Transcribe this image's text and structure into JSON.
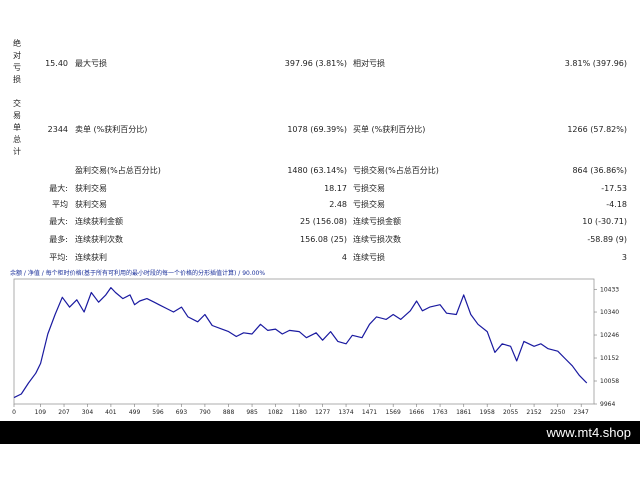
{
  "report": {
    "section1_label": "绝对亏损",
    "section2_label": "交易单总计",
    "rows": [
      {
        "c1": "15.40",
        "c2": "最大亏损",
        "c3": "397.96 (3.81%)",
        "c4": "相对亏损",
        "c5": "3.81% (397.96)"
      },
      {
        "c1": "2344",
        "c2": "卖单 (%获利百分比)",
        "c3": "1078 (69.39%)",
        "c4": "买单 (%获利百分比)",
        "c5": "1266 (57.82%)"
      },
      {
        "c1": "",
        "c2": "盈利交易(%占总百分比)",
        "c3": "1480 (63.14%)",
        "c4": "亏损交易(%占总百分比)",
        "c5": "864 (36.86%)"
      },
      {
        "c1": "最大:",
        "c2": "获利交易",
        "c3": "18.17",
        "c4": "亏损交易",
        "c5": "-17.53"
      },
      {
        "c1": "平均",
        "c2": "获利交易",
        "c3": "2.48",
        "c4": "亏损交易",
        "c5": "-4.18"
      },
      {
        "c1": "最大:",
        "c2": "连续获利金额",
        "c3": "25 (156.08)",
        "c4": "连续亏损金额",
        "c5": "10 (-30.71)"
      },
      {
        "c1": "最多:",
        "c2": "连续获利次数",
        "c3": "156.08 (25)",
        "c4": "连续亏损次数",
        "c5": "-58.89 (9)"
      },
      {
        "c1": "平均:",
        "c2": "连续获利",
        "c3": "4",
        "c4": "连续亏损",
        "c5": "3"
      }
    ]
  },
  "chart_data": {
    "type": "line",
    "title": "余额 / 净值 / 每个柜时价格(基于所有可利用的最小时段的每一个价格的分形插值计算) / 90.00%",
    "x_ticks": [
      "0",
      "109",
      "207",
      "304",
      "401",
      "499",
      "596",
      "693",
      "790",
      "888",
      "985",
      "1082",
      "1180",
      "1277",
      "1374",
      "1471",
      "1569",
      "1666",
      "1763",
      "1861",
      "1958",
      "2055",
      "2152",
      "2250",
      "2347"
    ],
    "y_ticks": [
      "10433",
      "10340",
      "10246",
      "10152",
      "10058",
      "9964"
    ],
    "ylim": [
      9964,
      10475
    ],
    "xlim": [
      0,
      2400
    ],
    "series": [
      {
        "color": "#1a1aa0",
        "x": [
          0,
          30,
          60,
          90,
          110,
          140,
          170,
          200,
          230,
          260,
          290,
          320,
          350,
          380,
          401,
          420,
          450,
          480,
          499,
          520,
          550,
          580,
          600,
          630,
          660,
          693,
          720,
          760,
          790,
          820,
          860,
          888,
          920,
          950,
          985,
          1020,
          1050,
          1082,
          1110,
          1140,
          1180,
          1210,
          1250,
          1277,
          1310,
          1340,
          1374,
          1400,
          1440,
          1471,
          1500,
          1540,
          1569,
          1600,
          1640,
          1666,
          1690,
          1720,
          1763,
          1790,
          1830,
          1861,
          1890,
          1920,
          1958,
          1990,
          2020,
          2055,
          2080,
          2110,
          2152,
          2180,
          2210,
          2250,
          2280,
          2310,
          2340,
          2370
        ],
        "y": [
          9990,
          10005,
          10050,
          10090,
          10130,
          10250,
          10330,
          10400,
          10360,
          10390,
          10340,
          10420,
          10380,
          10410,
          10440,
          10420,
          10395,
          10410,
          10370,
          10385,
          10395,
          10380,
          10370,
          10355,
          10340,
          10360,
          10320,
          10300,
          10330,
          10285,
          10270,
          10260,
          10240,
          10255,
          10250,
          10290,
          10265,
          10270,
          10250,
          10265,
          10260,
          10235,
          10255,
          10225,
          10260,
          10220,
          10210,
          10245,
          10235,
          10290,
          10320,
          10310,
          10330,
          10310,
          10345,
          10385,
          10345,
          10360,
          10370,
          10335,
          10330,
          10410,
          10330,
          10290,
          10260,
          10175,
          10210,
          10200,
          10140,
          10220,
          10200,
          10210,
          10190,
          10180,
          10150,
          10120,
          10080,
          10050
        ]
      }
    ]
  },
  "footer": {
    "site": "www.mt4.shop"
  }
}
